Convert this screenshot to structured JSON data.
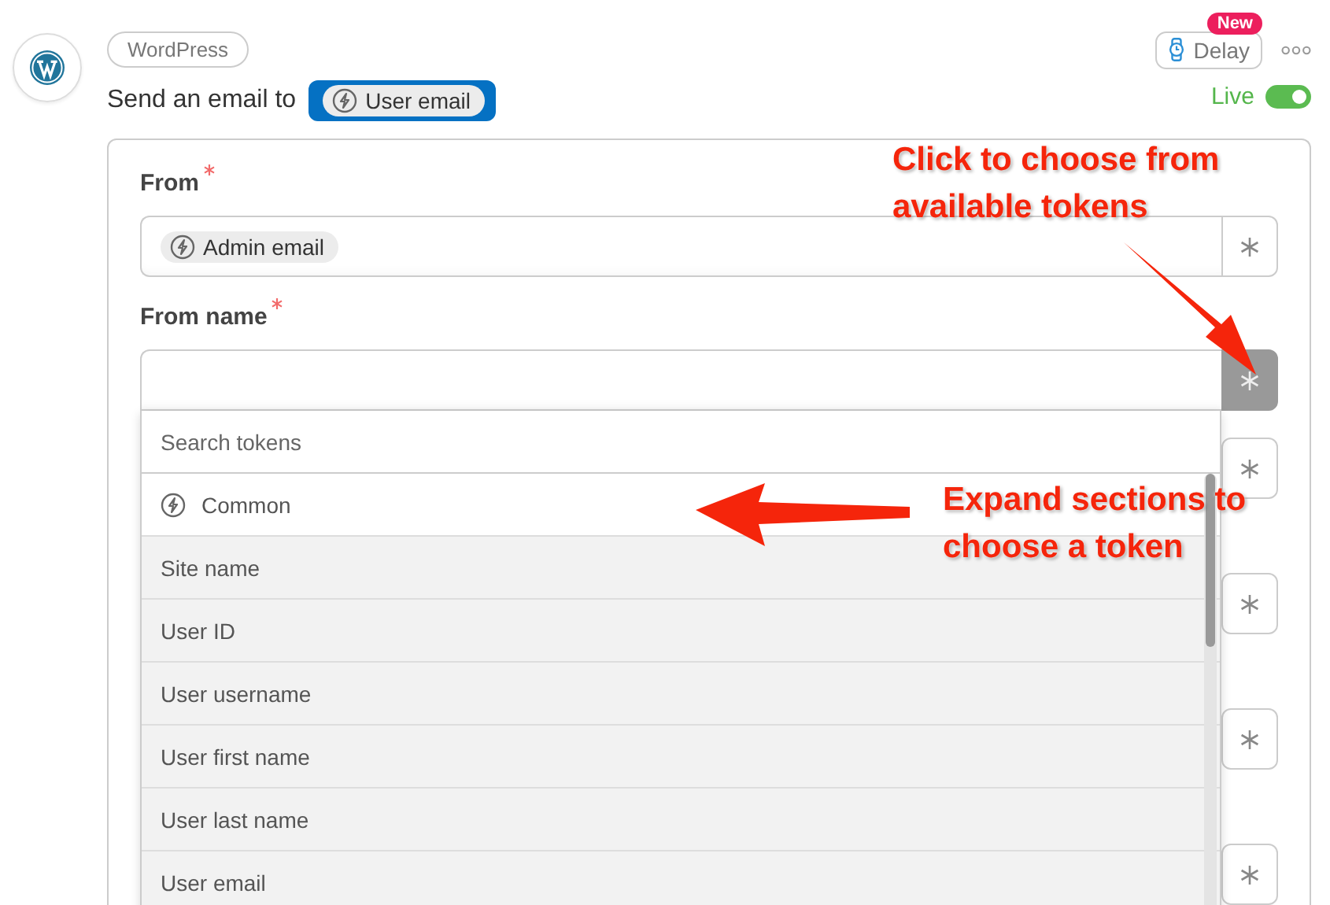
{
  "app_badge": "WordPress",
  "action": {
    "prefix": "Send an email to",
    "token": "User email"
  },
  "delay": {
    "label": "Delay",
    "badge": "New"
  },
  "live": {
    "label": "Live",
    "on": true
  },
  "fields": [
    {
      "label": "From",
      "required": true,
      "token": "Admin email",
      "picker_open": false
    },
    {
      "label": "From name",
      "required": true,
      "picker_open": true
    }
  ],
  "token_picker": {
    "placeholder": "Search tokens",
    "items": [
      {
        "label": "Common",
        "kind": "section"
      },
      {
        "label": "Site name",
        "kind": "token"
      },
      {
        "label": "User ID",
        "kind": "token"
      },
      {
        "label": "User username",
        "kind": "token"
      },
      {
        "label": "User first name",
        "kind": "token"
      },
      {
        "label": "User last name",
        "kind": "token"
      },
      {
        "label": "User email",
        "kind": "token"
      }
    ]
  },
  "annotations": [
    {
      "text": "Click to choose from available tokens"
    },
    {
      "text": "Expand sections to choose a token"
    }
  ]
}
